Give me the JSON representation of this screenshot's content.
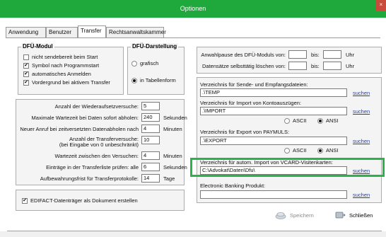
{
  "window": {
    "title": "Optionen",
    "close_label": "×"
  },
  "tabs": [
    {
      "label": "Anwendung"
    },
    {
      "label": "Benutzer"
    },
    {
      "label": "Transfer"
    },
    {
      "label": "Rechtsanwaltskammer"
    }
  ],
  "dfu_modul": {
    "title": "DFÜ-Modul",
    "options": [
      {
        "label": "nicht sendebereit beim Start",
        "checked": false
      },
      {
        "label": "Symbol nach Programmstart",
        "checked": true
      },
      {
        "label": "automatisches Anmelden",
        "checked": true
      },
      {
        "label": "Vordergrund bei aktivem Transfer",
        "checked": true
      }
    ]
  },
  "dfu_darstellung": {
    "title": "DFÜ-Darstellung",
    "options": [
      {
        "label": "grafisch",
        "selected": false
      },
      {
        "label": "in Tabellenform",
        "selected": true
      }
    ]
  },
  "settings": {
    "wiederaufsetz_label": "Anzahl der Wiederaufsetzversuche:",
    "wiederaufsetz_value": "5",
    "wartezeit_label": "Maximale Wartezeit bei Daten sofort abholen:",
    "wartezeit_value": "240",
    "wartezeit_unit": "Sekunden",
    "neuer_anruf_label": "Neuer Anruf bei zeitversetzten Datenabholen nach",
    "neuer_anruf_value": "4",
    "neuer_anruf_unit": "Minuten",
    "transferversuche_label": "Anzahl der Transferversuche:",
    "transferversuche_value": "10",
    "transferversuche_hint": "(bei Eingabe von 0 unbeschränkt)",
    "warte_versuche_label": "Wartezeit zwischen den Versuchen:",
    "warte_versuche_value": "4",
    "warte_versuche_unit": "Minuten",
    "eintraege_label": "Einträge in der Transferliste prüfen: alle",
    "eintraege_value": "6",
    "eintraege_unit": "Sekunden",
    "aufbewahrung_label": "Aufbewahrungsfrist für Transferprotokolle:",
    "aufbewahrung_value": "14",
    "aufbewahrung_unit": "Tage"
  },
  "edifact": {
    "label": "EDIFACT-Datenträger als Dokument erstellen",
    "checked": true
  },
  "anwahlpause": {
    "label": "Anwahlpause des DFÜ-Moduls von:",
    "from": "",
    "bis_label": "bis:",
    "to": "",
    "unit": "Uhr"
  },
  "datensaetze": {
    "label": "Datensätze selbsttätig löschen von:",
    "from": "",
    "bis_label": "bis:",
    "to": "",
    "unit": "Uhr"
  },
  "directories": {
    "send_receive": {
      "label": "Verzeichnis für Sende- und Empfangsdateien:",
      "value": ".\\TEMP",
      "link": "suchen"
    },
    "import_konto": {
      "label": "Verzeichnis für Import von Kontoauszügen:",
      "value": ".\\IMPORT",
      "link": "suchen"
    },
    "import_encoding": [
      {
        "label": "ASCII",
        "selected": false
      },
      {
        "label": "ANSI",
        "selected": true
      }
    ],
    "export_paymuls": {
      "label": "Verzeichnis für Export von PAYMULS:",
      "value": ".\\EXPORT",
      "link": "suchen"
    },
    "export_encoding": [
      {
        "label": "ASCII",
        "selected": false
      },
      {
        "label": "ANSI",
        "selected": true
      }
    ],
    "vcard_import": {
      "label": "Verzeichnis für autom. Import von VCARD-Visitenkarten:",
      "value": "C:\\Advokat\\Daten\\Dfu\\",
      "link": "suchen"
    },
    "banking": {
      "label": "Electronic Banking Produkt:",
      "value": "",
      "link": "suchen"
    }
  },
  "buttons": {
    "save": "Speichern",
    "close": "Schließen"
  },
  "colors": {
    "titlebar": "#1fa83b",
    "highlight": "#2bb24c",
    "link": "#1f3fb8"
  }
}
